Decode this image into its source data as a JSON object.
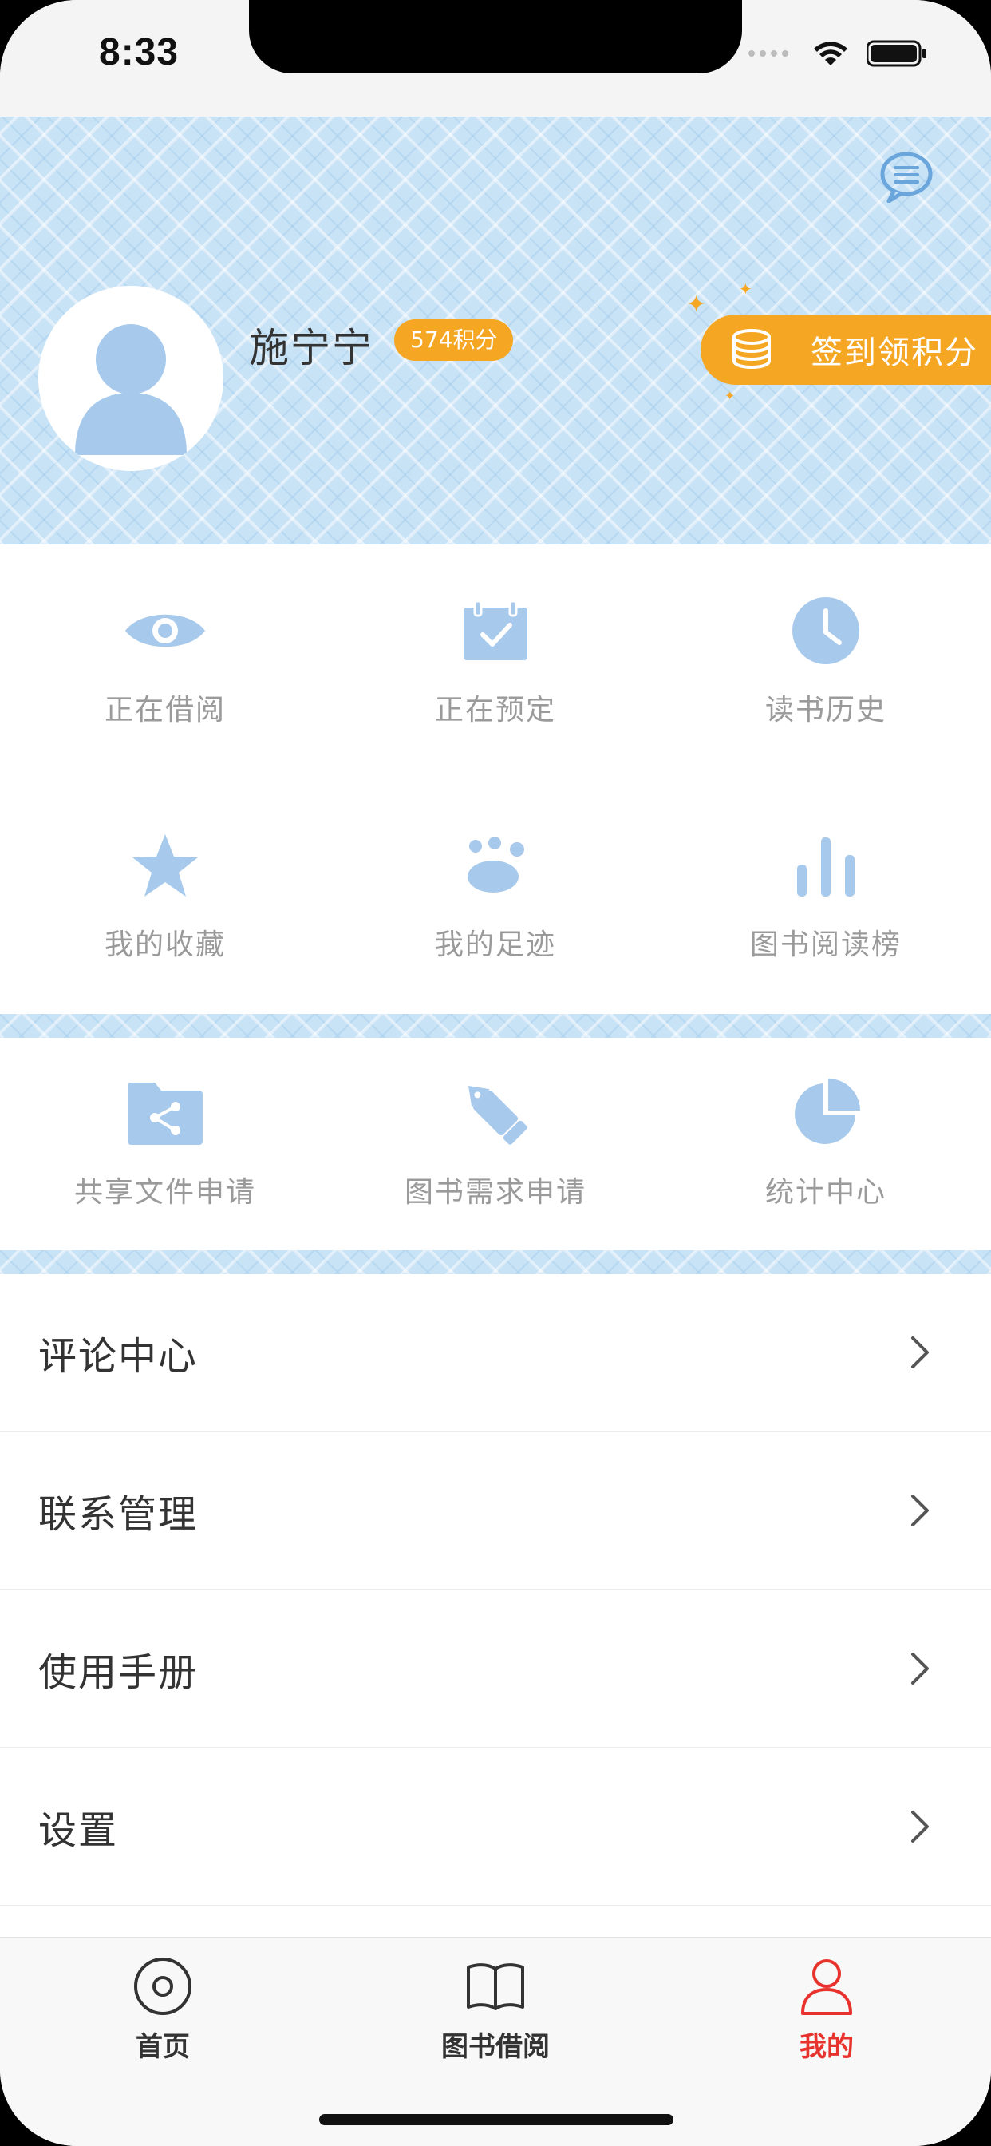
{
  "status_bar": {
    "time": "8:33"
  },
  "profile": {
    "name": "施宁宁",
    "points_badge": "574积分",
    "checkin_label": "签到领积分"
  },
  "quick_actions": [
    {
      "label": "正在借阅",
      "icon": "eye-icon"
    },
    {
      "label": "正在预定",
      "icon": "calendar-check-icon"
    },
    {
      "label": "读书历史",
      "icon": "clock-icon"
    },
    {
      "label": "我的收藏",
      "icon": "star-icon"
    },
    {
      "label": "我的足迹",
      "icon": "paw-icon"
    },
    {
      "label": "图书阅读榜",
      "icon": "bar-chart-icon"
    }
  ],
  "services": [
    {
      "label": "共享文件申请",
      "icon": "shared-folder-icon"
    },
    {
      "label": "图书需求申请",
      "icon": "pen-icon"
    },
    {
      "label": "统计中心",
      "icon": "pie-chart-icon"
    }
  ],
  "menu": [
    {
      "label": "评论中心"
    },
    {
      "label": "联系管理"
    },
    {
      "label": "使用手册"
    },
    {
      "label": "设置"
    }
  ],
  "tabs": [
    {
      "label": "首页",
      "icon": "home-disc-icon",
      "active": false
    },
    {
      "label": "图书借阅",
      "icon": "book-icon",
      "active": false
    },
    {
      "label": "我的",
      "icon": "person-icon",
      "active": true
    }
  ],
  "colors": {
    "accent_orange": "#f5a623",
    "icon_blue": "#a6c9ec",
    "active_red": "#e8322e"
  }
}
